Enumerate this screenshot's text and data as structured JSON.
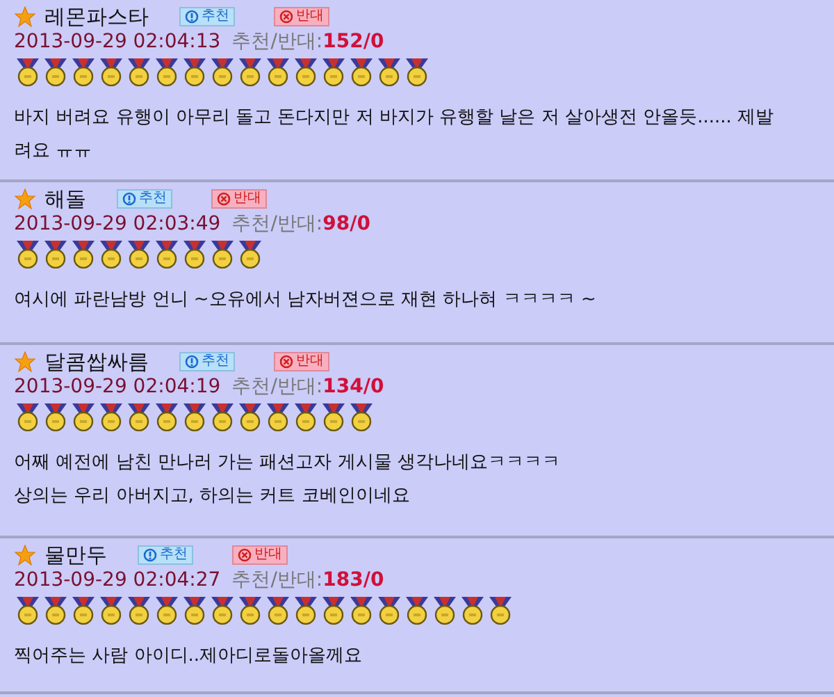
{
  "comments": [
    {
      "author": "레몬파스타",
      "recommend_button": "추천",
      "oppose_button": "반대",
      "datetime": "2013-09-29 02:04:13",
      "votes_label": "추천/반대:",
      "votes": "152/0",
      "lines": [
        "바지 버려요 유행이 아무리 돌고 돈다지만 저 바지가 유행할 날은 저 살아생전 안올듯...... 제발",
        "려요 ㅠㅠ"
      ],
      "medals": [
        {
          "kind": "gold"
        },
        {
          "kind": "gold"
        },
        {
          "kind": "gold"
        },
        {
          "kind": "gold"
        },
        {
          "kind": "gold"
        },
        {
          "kind": "gold"
        },
        {
          "kind": "gold"
        },
        {
          "kind": "gold"
        },
        {
          "kind": "gold"
        },
        {
          "kind": "gold"
        },
        {
          "kind": "gold"
        },
        {
          "kind": "gold"
        },
        {
          "kind": "gold"
        },
        {
          "kind": "gold"
        },
        {
          "kind": "gold"
        }
      ]
    },
    {
      "author": "해돌",
      "recommend_button": "추천",
      "oppose_button": "반대",
      "datetime": "2013-09-29 02:03:49",
      "votes_label": "추천/반대:",
      "votes": "98/0",
      "lines": [
        "여시에 파란남방 언니 ~오유에서 남자버젼으로 재현 하나혀 ㅋㅋㅋㅋ ~"
      ],
      "medals": [
        {
          "kind": "gold"
        },
        {
          "kind": "gold"
        },
        {
          "kind": "gold"
        },
        {
          "kind": "gold"
        },
        {
          "kind": "gold"
        },
        {
          "kind": "gold"
        },
        {
          "kind": "gold"
        },
        {
          "kind": "gold"
        },
        {
          "kind": "gold"
        }
      ]
    },
    {
      "author": "달콤쌉싸름",
      "recommend_button": "추천",
      "oppose_button": "반대",
      "datetime": "2013-09-29 02:04:19",
      "votes_label": "추천/반대:",
      "votes": "134/0",
      "lines": [
        "어째 예전에 남친 만나러 가는 패션고자 게시물 생각나네요ㅋㅋㅋㅋ",
        "상의는 우리 아버지고, 하의는 커트 코베인이네요"
      ],
      "medals": [
        {
          "kind": "gold"
        },
        {
          "kind": "gold"
        },
        {
          "kind": "gold"
        },
        {
          "kind": "gold"
        },
        {
          "kind": "gold"
        },
        {
          "kind": "gold"
        },
        {
          "kind": "gold"
        },
        {
          "kind": "gold"
        },
        {
          "kind": "gold"
        },
        {
          "kind": "gold"
        },
        {
          "kind": "gold"
        },
        {
          "kind": "gold"
        },
        {
          "kind": "gold"
        }
      ]
    },
    {
      "author": "물만두",
      "recommend_button": "추천",
      "oppose_button": "반대",
      "datetime": "2013-09-29 02:04:27",
      "votes_label": "추천/반대:",
      "votes": "183/0",
      "lines": [
        "찍어주는 사람 아이디..제아디로돌아올께요"
      ],
      "medals": [
        {
          "kind": "gold"
        },
        {
          "kind": "gold"
        },
        {
          "kind": "gold"
        },
        {
          "kind": "gold"
        },
        {
          "kind": "gold"
        },
        {
          "kind": "gold"
        },
        {
          "kind": "gold"
        },
        {
          "kind": "gold"
        },
        {
          "kind": "gold"
        },
        {
          "kind": "gold"
        },
        {
          "kind": "gold"
        },
        {
          "kind": "gold"
        },
        {
          "kind": "gold"
        },
        {
          "kind": "gold"
        },
        {
          "kind": "gold"
        },
        {
          "kind": "gold"
        },
        {
          "kind": "gold"
        },
        {
          "kind": "gold"
        }
      ]
    }
  ]
}
